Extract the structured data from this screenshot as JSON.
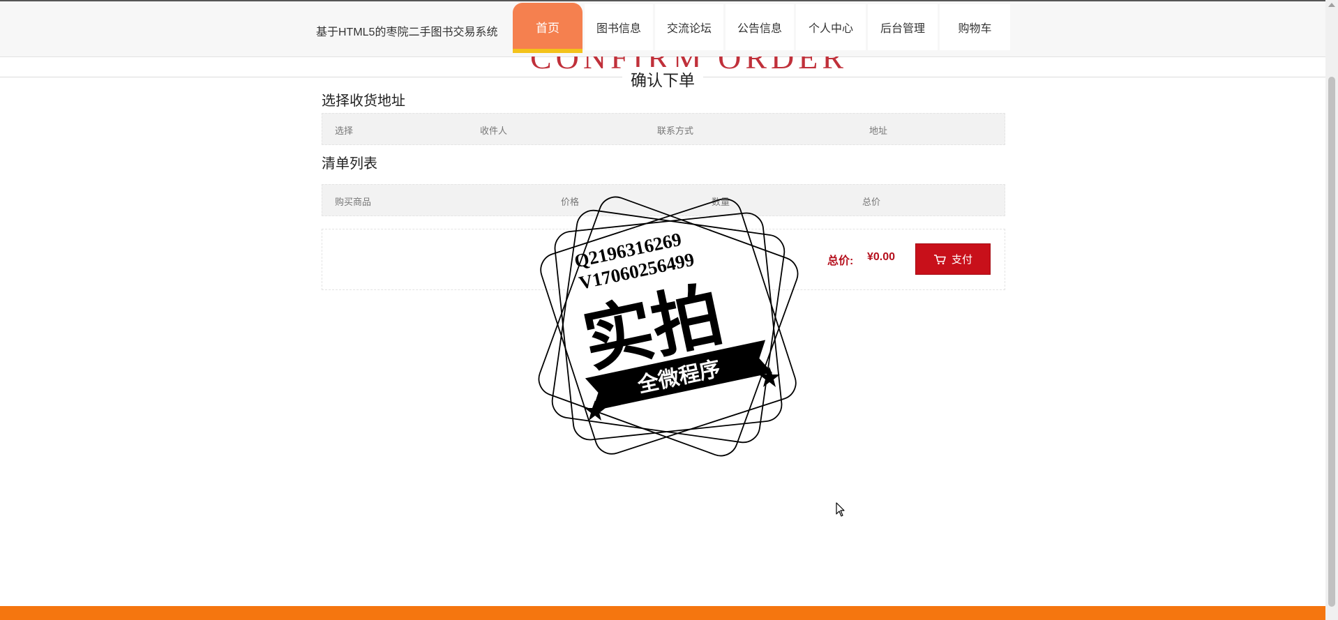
{
  "header": {
    "site_title": "基于HTML5的枣院二手图书交易系统",
    "nav": [
      {
        "label": "首页",
        "active": true
      },
      {
        "label": "图书信息"
      },
      {
        "label": "交流论坛"
      },
      {
        "label": "公告信息"
      },
      {
        "label": "个人中心"
      },
      {
        "label": "后台管理"
      },
      {
        "label": "购物车"
      }
    ]
  },
  "page": {
    "banner_ghost": "CONFIRM ORDER",
    "heading": "确认下单"
  },
  "address_section": {
    "title": "选择收货地址",
    "columns": [
      "选择",
      "收件人",
      "联系方式",
      "地址"
    ]
  },
  "order_section": {
    "title": "清单列表",
    "columns": [
      "购买商品",
      "价格",
      "数量",
      "总价"
    ]
  },
  "summary": {
    "total_label": "总价:",
    "total_value": "¥0.00",
    "pay_label": "支付"
  },
  "watermark": {
    "line1": "Q2196316269",
    "line2": "V17060256499",
    "big_text": "实拍",
    "ribbon_text": "全微程序"
  },
  "colors": {
    "accent_orange": "#f5804f",
    "accent_yellow": "#f3c21a",
    "pay_red": "#c8101a",
    "price_red": "#b5101d",
    "footer_orange": "#f5760f"
  }
}
